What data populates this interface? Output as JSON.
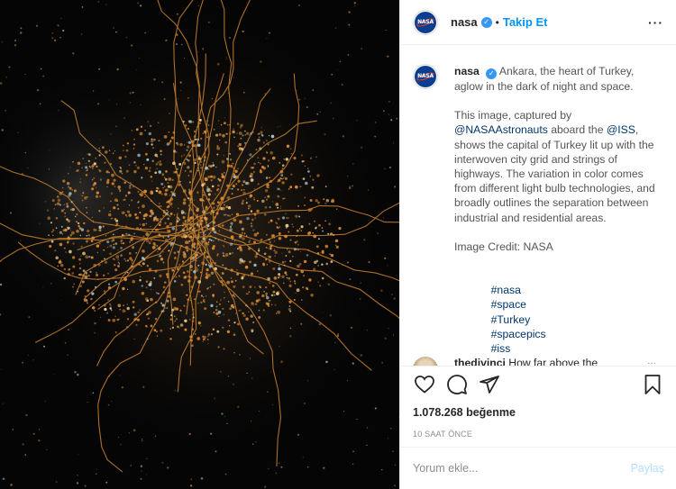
{
  "post": {
    "username": "nasa",
    "follow_label": "Takip Et",
    "more_label": "···",
    "avatar_text": "NASA",
    "verified_mark": "✓",
    "photo_alt": "Ankara at night from space"
  },
  "caption": {
    "username": "nasa",
    "lead": "Ankara, the heart of Turkey, aglow in the dark of night and space.",
    "para1_pre": "This image, captured by ",
    "mention1": "@NASAAstronauts",
    "para1_mid": " aboard the ",
    "mention2": "@ISS",
    "para1_post": ", shows the capital of Turkey lit up with the interwoven city grid and strings of highways. The variation in color comes from different light bulb technologies, and broadly outlines the separation between industrial and residential areas.",
    "credit": "Image Credit: NASA",
    "hashtags": [
      "#nasa",
      "#space",
      "#Turkey",
      "#spacepics",
      "#iss"
    ],
    "time": "10s"
  },
  "comment": {
    "username": "thedivinci",
    "text": "How far above the",
    "more": "···"
  },
  "stats": {
    "likes": "1.078.268 beğenme",
    "posted": "10 SAAT ÖNCE"
  },
  "comment_box": {
    "placeholder": "Yorum ekle...",
    "post_label": "Paylaş"
  },
  "colors": {
    "accent": "#0095f6",
    "verified": "#3897f0",
    "city_lights": "#d9892e",
    "night": "#050505"
  },
  "icons": {
    "like": "heart-icon",
    "comment": "comment-icon",
    "share": "send-icon",
    "save": "bookmark-icon"
  }
}
